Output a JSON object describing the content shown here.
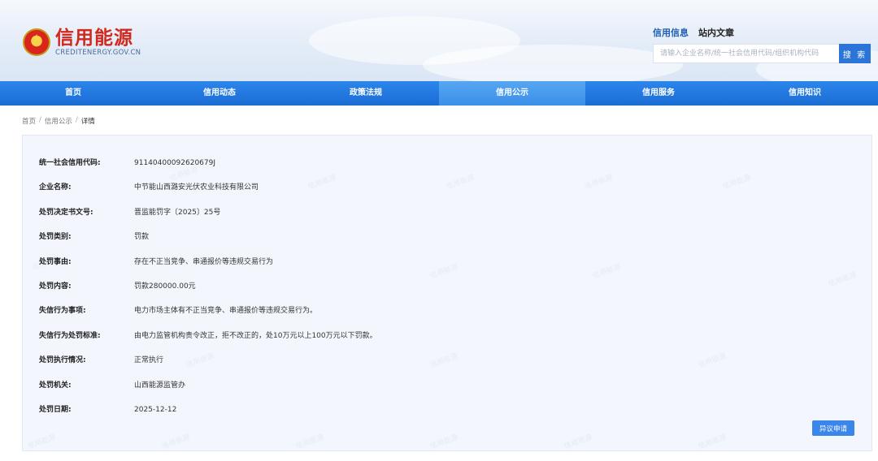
{
  "site": {
    "title": "信用能源",
    "subtitle": "CREDITENERGY.GOV.CN"
  },
  "search": {
    "tabs": [
      "信用信息",
      "站内文章"
    ],
    "placeholder": "请输入企业名称/统一社会信用代码/组织机构代码",
    "button_label": "搜 索"
  },
  "nav": {
    "items": [
      "首页",
      "信用动态",
      "政策法规",
      "信用公示",
      "信用服务",
      "信用知识"
    ],
    "active": "信用公示"
  },
  "breadcrumb": {
    "home": "首页",
    "section": "信用公示",
    "current": "详情",
    "separator": "/"
  },
  "detail": {
    "rows": [
      {
        "label": "统一社会信用代码:",
        "value": "91140400092620679J"
      },
      {
        "label": "企业名称:",
        "value": "中节能山西潞安光伏农业科技有限公司"
      },
      {
        "label": "处罚决定书文号:",
        "value": "晋监能罚字〔2025〕25号"
      },
      {
        "label": "处罚类别:",
        "value": "罚款"
      },
      {
        "label": "处罚事由:",
        "value": "存在不正当竞争、串通报价等违规交易行为"
      },
      {
        "label": "处罚内容:",
        "value": "罚款280000.00元"
      },
      {
        "label": "失信行为事项:",
        "value": "电力市场主体有不正当竞争、串通报价等违规交易行为。"
      },
      {
        "label": "失信行为处罚标准:",
        "value": "由电力监管机构责令改正，拒不改正的，处10万元以上100万元以下罚款。"
      },
      {
        "label": "处罚执行情况:",
        "value": "正常执行"
      },
      {
        "label": "处罚机关:",
        "value": "山西能源监管办"
      },
      {
        "label": "处罚日期:",
        "value": "2025-12-12"
      }
    ],
    "appeal_button": "异议申请"
  },
  "colors": {
    "brand_red": "#d3261d",
    "nav_blue": "#1a6cd5",
    "accent_blue": "#2b74d8"
  }
}
